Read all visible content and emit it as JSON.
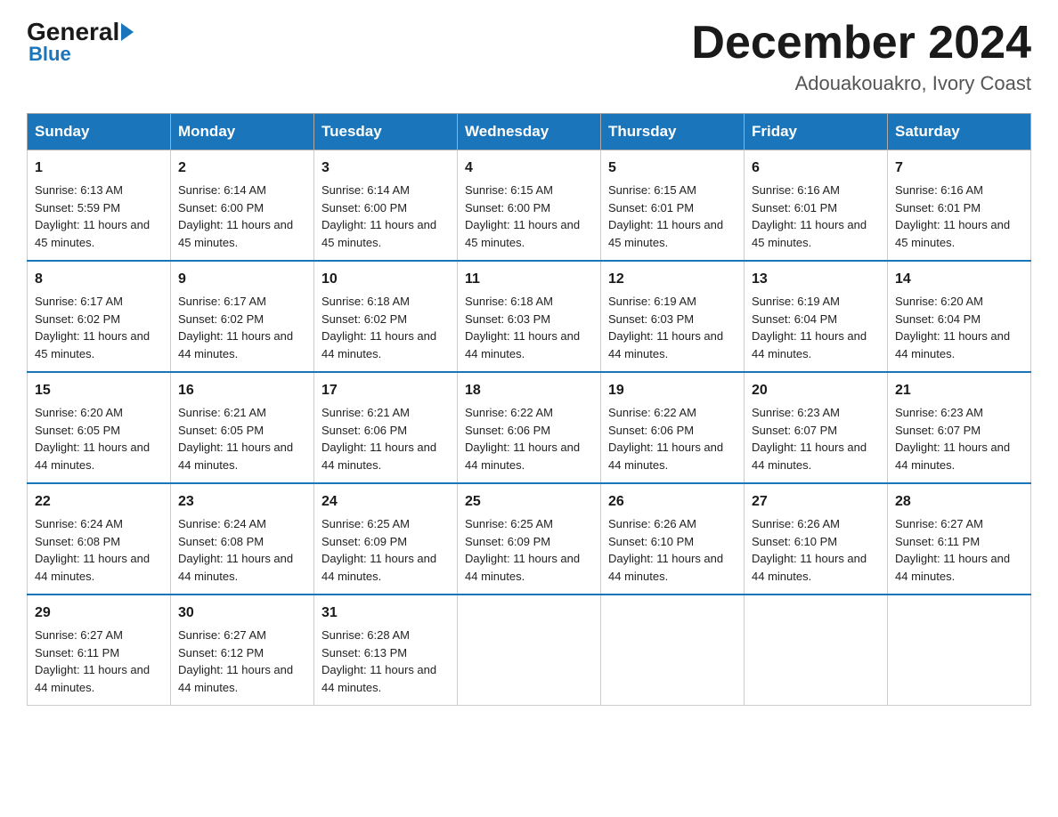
{
  "logo": {
    "general": "General",
    "blue": "Blue"
  },
  "title": "December 2024",
  "location": "Adouakouakro, Ivory Coast",
  "days_of_week": [
    "Sunday",
    "Monday",
    "Tuesday",
    "Wednesday",
    "Thursday",
    "Friday",
    "Saturday"
  ],
  "weeks": [
    [
      {
        "day": "1",
        "sunrise": "6:13 AM",
        "sunset": "5:59 PM",
        "daylight": "11 hours and 45 minutes."
      },
      {
        "day": "2",
        "sunrise": "6:14 AM",
        "sunset": "6:00 PM",
        "daylight": "11 hours and 45 minutes."
      },
      {
        "day": "3",
        "sunrise": "6:14 AM",
        "sunset": "6:00 PM",
        "daylight": "11 hours and 45 minutes."
      },
      {
        "day": "4",
        "sunrise": "6:15 AM",
        "sunset": "6:00 PM",
        "daylight": "11 hours and 45 minutes."
      },
      {
        "day": "5",
        "sunrise": "6:15 AM",
        "sunset": "6:01 PM",
        "daylight": "11 hours and 45 minutes."
      },
      {
        "day": "6",
        "sunrise": "6:16 AM",
        "sunset": "6:01 PM",
        "daylight": "11 hours and 45 minutes."
      },
      {
        "day": "7",
        "sunrise": "6:16 AM",
        "sunset": "6:01 PM",
        "daylight": "11 hours and 45 minutes."
      }
    ],
    [
      {
        "day": "8",
        "sunrise": "6:17 AM",
        "sunset": "6:02 PM",
        "daylight": "11 hours and 45 minutes."
      },
      {
        "day": "9",
        "sunrise": "6:17 AM",
        "sunset": "6:02 PM",
        "daylight": "11 hours and 44 minutes."
      },
      {
        "day": "10",
        "sunrise": "6:18 AM",
        "sunset": "6:02 PM",
        "daylight": "11 hours and 44 minutes."
      },
      {
        "day": "11",
        "sunrise": "6:18 AM",
        "sunset": "6:03 PM",
        "daylight": "11 hours and 44 minutes."
      },
      {
        "day": "12",
        "sunrise": "6:19 AM",
        "sunset": "6:03 PM",
        "daylight": "11 hours and 44 minutes."
      },
      {
        "day": "13",
        "sunrise": "6:19 AM",
        "sunset": "6:04 PM",
        "daylight": "11 hours and 44 minutes."
      },
      {
        "day": "14",
        "sunrise": "6:20 AM",
        "sunset": "6:04 PM",
        "daylight": "11 hours and 44 minutes."
      }
    ],
    [
      {
        "day": "15",
        "sunrise": "6:20 AM",
        "sunset": "6:05 PM",
        "daylight": "11 hours and 44 minutes."
      },
      {
        "day": "16",
        "sunrise": "6:21 AM",
        "sunset": "6:05 PM",
        "daylight": "11 hours and 44 minutes."
      },
      {
        "day": "17",
        "sunrise": "6:21 AM",
        "sunset": "6:06 PM",
        "daylight": "11 hours and 44 minutes."
      },
      {
        "day": "18",
        "sunrise": "6:22 AM",
        "sunset": "6:06 PM",
        "daylight": "11 hours and 44 minutes."
      },
      {
        "day": "19",
        "sunrise": "6:22 AM",
        "sunset": "6:06 PM",
        "daylight": "11 hours and 44 minutes."
      },
      {
        "day": "20",
        "sunrise": "6:23 AM",
        "sunset": "6:07 PM",
        "daylight": "11 hours and 44 minutes."
      },
      {
        "day": "21",
        "sunrise": "6:23 AM",
        "sunset": "6:07 PM",
        "daylight": "11 hours and 44 minutes."
      }
    ],
    [
      {
        "day": "22",
        "sunrise": "6:24 AM",
        "sunset": "6:08 PM",
        "daylight": "11 hours and 44 minutes."
      },
      {
        "day": "23",
        "sunrise": "6:24 AM",
        "sunset": "6:08 PM",
        "daylight": "11 hours and 44 minutes."
      },
      {
        "day": "24",
        "sunrise": "6:25 AM",
        "sunset": "6:09 PM",
        "daylight": "11 hours and 44 minutes."
      },
      {
        "day": "25",
        "sunrise": "6:25 AM",
        "sunset": "6:09 PM",
        "daylight": "11 hours and 44 minutes."
      },
      {
        "day": "26",
        "sunrise": "6:26 AM",
        "sunset": "6:10 PM",
        "daylight": "11 hours and 44 minutes."
      },
      {
        "day": "27",
        "sunrise": "6:26 AM",
        "sunset": "6:10 PM",
        "daylight": "11 hours and 44 minutes."
      },
      {
        "day": "28",
        "sunrise": "6:27 AM",
        "sunset": "6:11 PM",
        "daylight": "11 hours and 44 minutes."
      }
    ],
    [
      {
        "day": "29",
        "sunrise": "6:27 AM",
        "sunset": "6:11 PM",
        "daylight": "11 hours and 44 minutes."
      },
      {
        "day": "30",
        "sunrise": "6:27 AM",
        "sunset": "6:12 PM",
        "daylight": "11 hours and 44 minutes."
      },
      {
        "day": "31",
        "sunrise": "6:28 AM",
        "sunset": "6:13 PM",
        "daylight": "11 hours and 44 minutes."
      },
      null,
      null,
      null,
      null
    ]
  ],
  "labels": {
    "sunrise": "Sunrise:",
    "sunset": "Sunset:",
    "daylight": "Daylight:"
  }
}
